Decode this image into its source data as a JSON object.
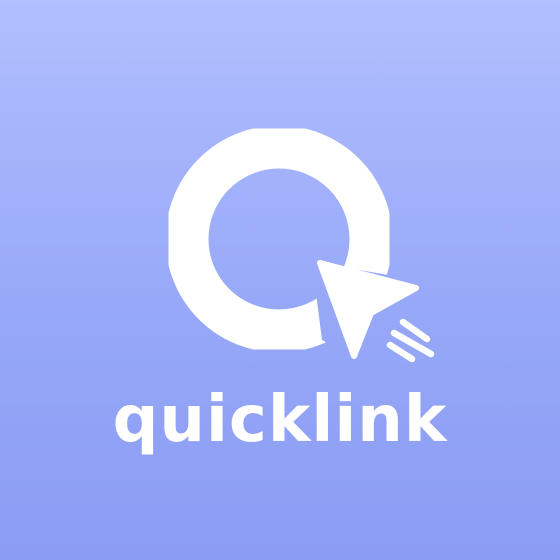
{
  "brand": {
    "wordmark": "quicklink",
    "icons": {
      "logo": "q-letter-logo-icon",
      "cursor": "cursor-arrow-icon",
      "motion": "speed-lines-icon"
    },
    "colors": {
      "background_top": "#b1bffd",
      "background_bottom": "#8b9cf3",
      "foreground": "#ffffff"
    }
  }
}
